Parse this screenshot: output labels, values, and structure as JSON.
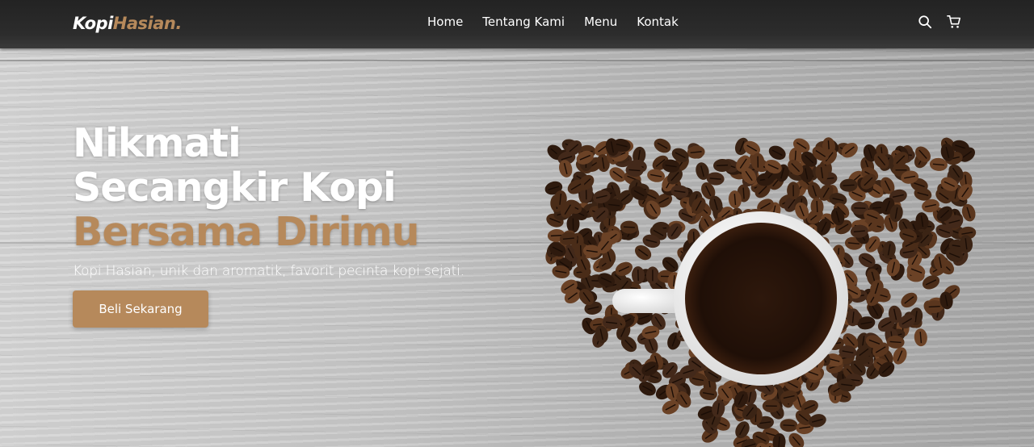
{
  "brand": {
    "name_main": "Kopi",
    "name_accent": "Hasian."
  },
  "nav": {
    "links": [
      {
        "label": "Home"
      },
      {
        "label": "Tentang Kami"
      },
      {
        "label": "Menu"
      },
      {
        "label": "Kontak"
      }
    ],
    "icons": [
      "search-icon",
      "shopping-cart-icon"
    ]
  },
  "hero": {
    "headline_line1": "Nikmati",
    "headline_line2": "Secangkir Kopi",
    "headline_accent": "Bersama Dirimu",
    "subtitle": "Kopi Hasian, unik dan aromatik, favorit pecinta kopi sejati.",
    "cta_label": "Beli Sekarang",
    "image": "heart-shaped-coffee-beans-with-cup"
  },
  "colors": {
    "accent": "#b6895b",
    "navbar": "#2a2a2a",
    "text": "#ffffff",
    "coffee": "#2a160c"
  }
}
